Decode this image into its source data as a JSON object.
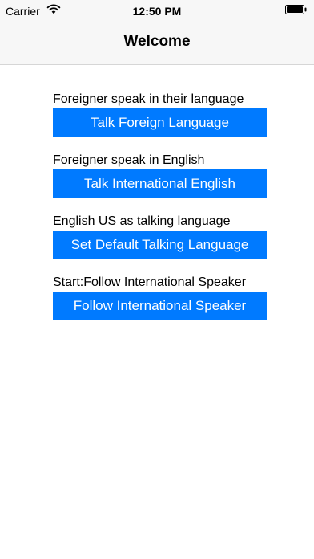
{
  "status_bar": {
    "carrier": "Carrier",
    "time": "12:50 PM",
    "wifi_icon": "wifi-icon",
    "battery_icon": "battery-icon"
  },
  "nav": {
    "title": "Welcome"
  },
  "colors": {
    "accent": "#007aff",
    "nav_background": "#f7f7f7",
    "background": "#ffffff"
  },
  "groups": [
    {
      "label": "Foreigner speak in their language",
      "button": "Talk Foreign Language"
    },
    {
      "label": "Foreigner speak in English",
      "button": "Talk International English"
    },
    {
      "label": "English US as talking language",
      "button": "Set Default Talking Language"
    },
    {
      "label": "Start:Follow International Speaker",
      "button": "Follow International Speaker"
    }
  ]
}
